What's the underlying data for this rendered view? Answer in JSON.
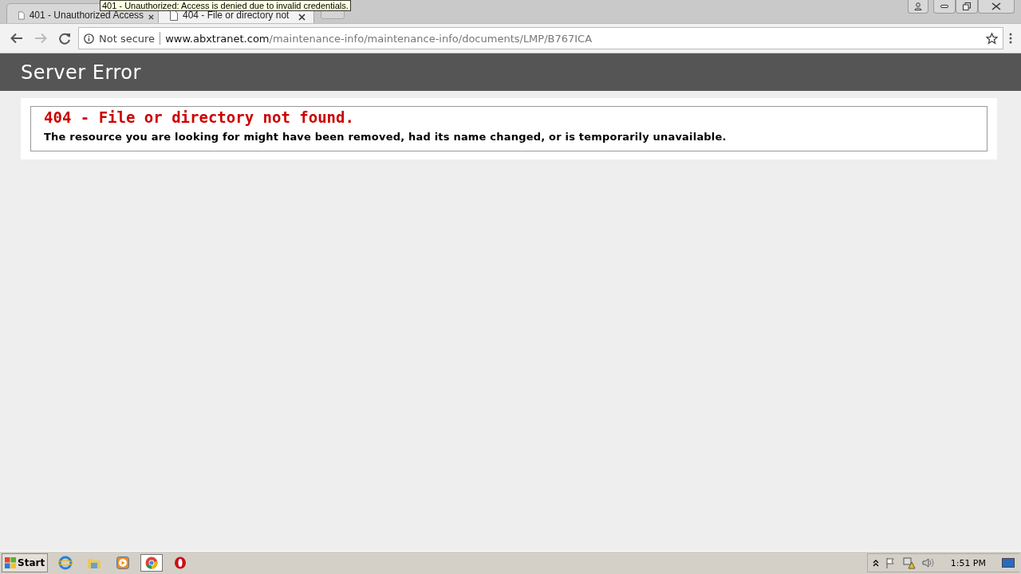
{
  "tabs": [
    {
      "title": "401 - Unauthorized Access",
      "selected": false
    },
    {
      "title": "404 - File or directory not",
      "selected": true
    }
  ],
  "tooltip": "401 - Unauthorized: Access is denied due to invalid credentials.",
  "address_bar": {
    "security": "Not secure",
    "domain": "www.abxtranet.com",
    "path": "/maintenance-info/maintenance-info/documents/LMP/B767ICA"
  },
  "page": {
    "header": "Server Error",
    "error_title": "404 - File or directory not found.",
    "error_message": "The resource you are looking for might have been removed, had its name changed, or is temporarily unavailable."
  },
  "taskbar": {
    "start": "Start",
    "apps": [
      {
        "kind": "ie",
        "selected": false
      },
      {
        "kind": "folder",
        "selected": false
      },
      {
        "kind": "media",
        "selected": false
      },
      {
        "kind": "chrome",
        "selected": true
      },
      {
        "kind": "opera",
        "selected": false
      }
    ],
    "clock": "1:51 PM"
  }
}
